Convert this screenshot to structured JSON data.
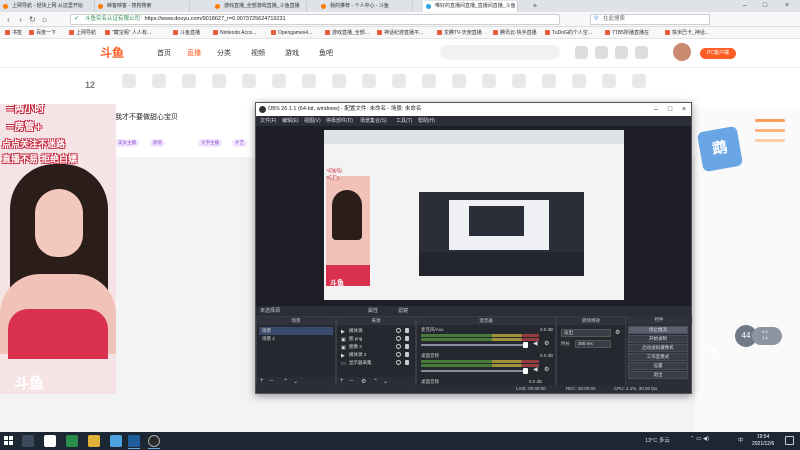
{
  "browser": {
    "tabs": [
      {
        "label": "上网导航 - 轻快上网 从这里开始"
      },
      {
        "label": "映客映客 - 搜狗搜索"
      },
      {
        "label": "游戏直播_全部游戏直播_斗鱼直播"
      },
      {
        "label": "我的推荐 - 个人中心 - 斗鱼"
      },
      {
        "label": "唯好的直播间直播_直播间直播_斗鱼"
      }
    ],
    "url_verified": "斗鱼实名认证有限公司",
    "url": "https://www.douyu.com/9018627_r=0.9073725624719231",
    "search_placeholder": "在此搜索",
    "bookmarks": [
      "书签",
      "百度一下",
      "上网导航",
      "\"藏宝阁\" 人人有...",
      "斗鱼直播",
      "Nintendo Acco...",
      "Opengames4...",
      "游戏直播_全部...",
      "神话纪游直播平...",
      "龙腾TV-天使直播",
      "腾讯云-快手直播",
      "TuDoG的个人空...",
      "7TB5所播直播在",
      "铁米巴卡_神话..."
    ]
  },
  "site": {
    "nav": [
      "首页",
      "直播",
      "分类",
      "视频",
      "游戏",
      "鱼吧"
    ],
    "pc_button": "PC客户端",
    "room_level": "12",
    "streamer_title": "我才不要做甜心宝贝",
    "tags": [
      "美女主播",
      "颜值",
      "文字主播",
      "才艺"
    ],
    "overlay_lines": [
      "=两小时",
      "=房管+",
      "点点关注不迷路",
      "直播不易 拒绝白嫖"
    ],
    "watermark": "斗鱼",
    "speed_badge": "44",
    "speed_up": "4.3",
    "speed_down": "1.4"
  },
  "obs": {
    "title": "OBS 26.1.1 (64-bit, windows) - 配置文件: 未命名 - 场景: 未命名",
    "menu": [
      "文件(F)",
      "编辑(E)",
      "视图(V)",
      "停靠部件(D)",
      "场景集合(S)",
      "工具(T)",
      "帮助(H)"
    ],
    "no_source": "未选择源",
    "properties": "属性",
    "filters": "滤镜",
    "scenes_header": "场景",
    "scenes": [
      "场景",
      "场景 2"
    ],
    "sources_header": "来源",
    "sources": [
      "媒体源",
      "图 png",
      "图像 3",
      "媒体源 3",
      "显示器采集"
    ],
    "mixer_header": "混音器",
    "mixer_channels": [
      {
        "name": "麦克风/Aux",
        "db": "0.0 dB"
      },
      {
        "name": "桌面音频",
        "db": "0.0 dB"
      },
      {
        "name": "桌面音频",
        "db": "0.0 dB"
      }
    ],
    "transitions_header": "转场特效",
    "transition_value": "淡出",
    "duration_label": "时长",
    "duration_value": "300 ms",
    "controls_header": "控件",
    "controls": [
      "停止推流",
      "开始录制",
      "启动虚拟摄像机",
      "工作室模式",
      "设置",
      "退出"
    ],
    "status": {
      "live": "LIVE: 00:00:00",
      "rec": "REC: 00:00:00",
      "cpu": "CPU: 4.1%, 30.00 fps"
    }
  },
  "taskbar": {
    "weather": "13°C 多云",
    "time": "19:54",
    "date": "2021/12/6",
    "lang": "中"
  }
}
